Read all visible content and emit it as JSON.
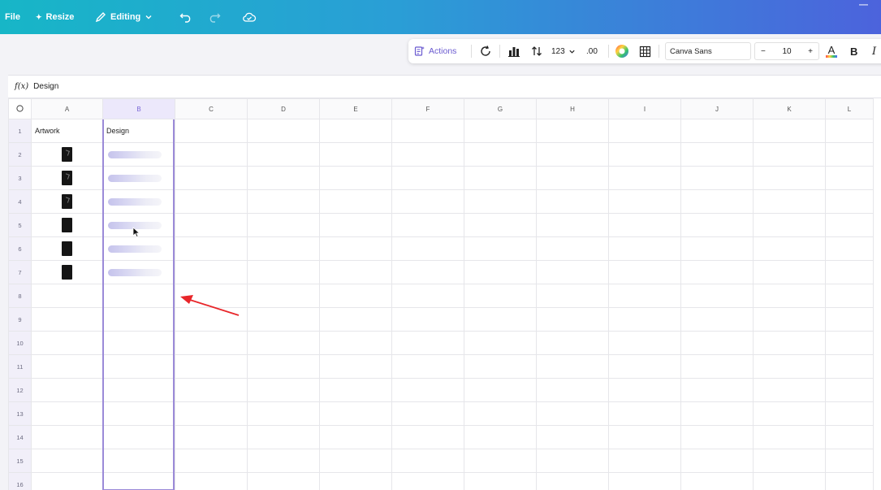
{
  "topbar": {
    "file": "File",
    "resize": "Resize",
    "editing": "Editing"
  },
  "toolbar": {
    "actions": "Actions",
    "number_format": "123",
    "decimals": ".00",
    "font_name": "Canva Sans",
    "font_size": "10",
    "minus": "−",
    "plus": "+",
    "bold": "B",
    "italic": "I",
    "text_color_letter": "A"
  },
  "formula_bar": {
    "fx": "f(x)",
    "value": "Design"
  },
  "sheet": {
    "columns": [
      "A",
      "B",
      "C",
      "D",
      "E",
      "F",
      "G",
      "H",
      "I",
      "J",
      "K",
      "L"
    ],
    "row_numbers": [
      "1",
      "2",
      "3",
      "4",
      "5",
      "6",
      "7",
      "8",
      "9",
      "10",
      "11",
      "12",
      "13",
      "14",
      "15",
      "16"
    ],
    "header_row": {
      "a": "Artwork",
      "b": "Design"
    },
    "selected_column": "B"
  },
  "colors": {
    "topbar_start": "#17b6c7",
    "topbar_end": "#4c63dc",
    "selection": "#9b8ad8",
    "annotation_arrow": "#e8262a"
  }
}
